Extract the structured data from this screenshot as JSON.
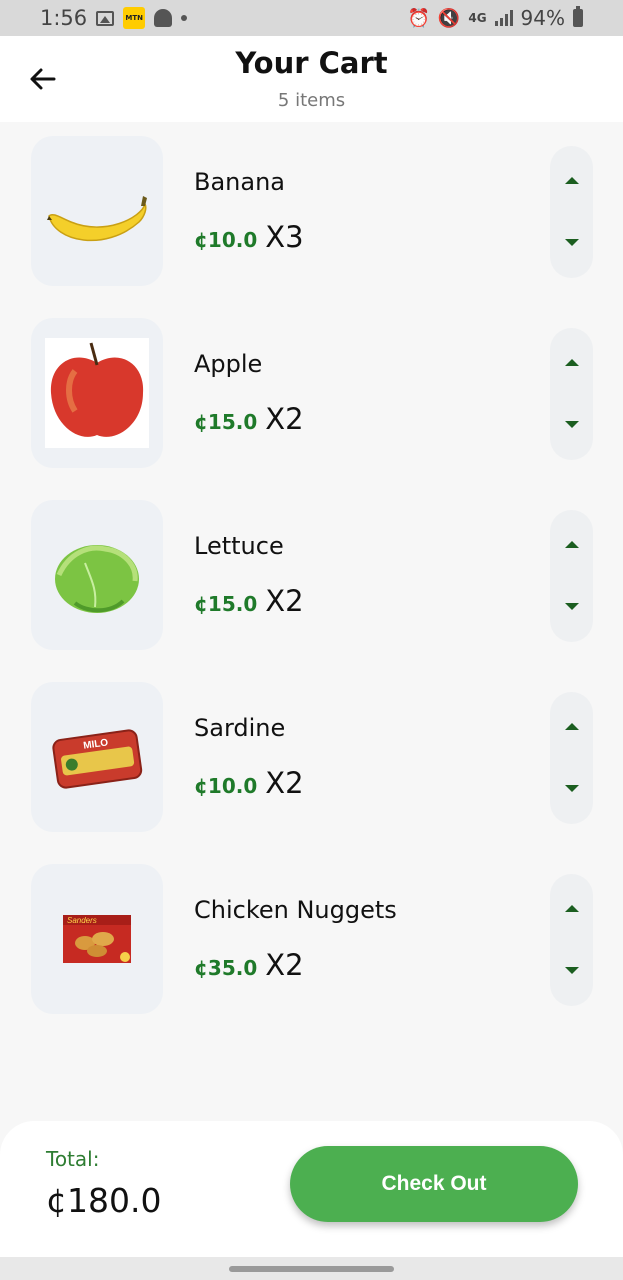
{
  "status_bar": {
    "time": "1:56",
    "network": "4G",
    "battery": "94%"
  },
  "header": {
    "title": "Your Cart",
    "subtitle": "5 items"
  },
  "items": [
    {
      "name": "Banana",
      "price": "¢10.0",
      "qty": "X3",
      "image": "banana"
    },
    {
      "name": "Apple",
      "price": "¢15.0",
      "qty": "X2",
      "image": "apple"
    },
    {
      "name": "Lettuce",
      "price": "¢15.0",
      "qty": "X2",
      "image": "lettuce"
    },
    {
      "name": "Sardine",
      "price": "¢10.0",
      "qty": "X2",
      "image": "sardine-can"
    },
    {
      "name": "Chicken Nuggets",
      "price": "¢35.0",
      "qty": "X2",
      "image": "nuggets-box"
    }
  ],
  "footer": {
    "total_label": "Total:",
    "total_value": "¢180.0",
    "checkout_label": "Check Out"
  },
  "images": {
    "sardine_brand": "MILO",
    "nuggets_brand": "Sanders"
  },
  "colors": {
    "accent": "#4caf50",
    "price": "#1f7a2a",
    "thumb_bg": "#eef1f5"
  }
}
